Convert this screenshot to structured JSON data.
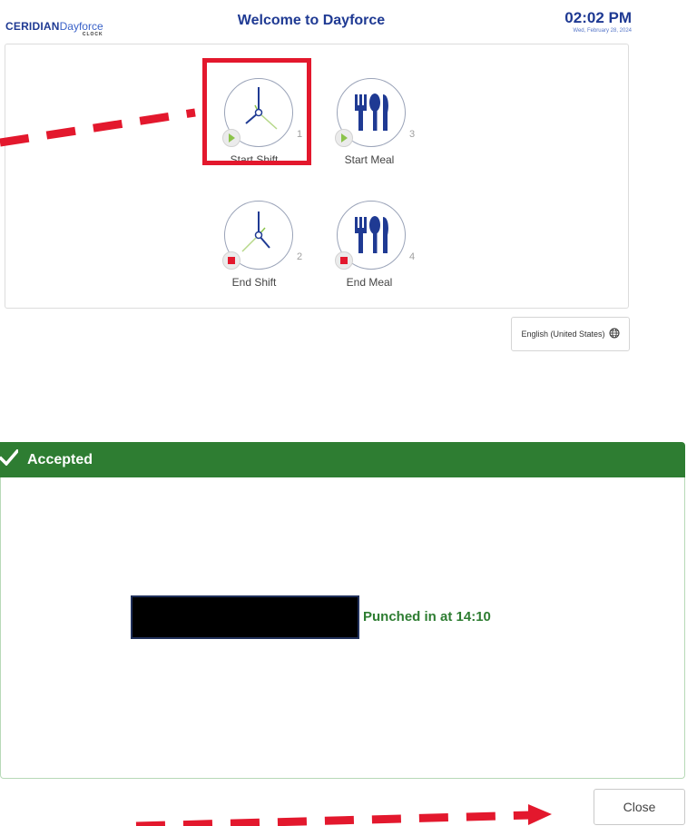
{
  "header": {
    "brand_primary": "CERIDIAN",
    "brand_secondary": "Dayforce",
    "brand_sub": "CLOCK",
    "title": "Welcome to Dayforce",
    "time": "02:02 PM",
    "date": "Wed, February 28, 2024"
  },
  "tiles": [
    {
      "label": "Start Shift",
      "number": "1",
      "icon": "clock-icon",
      "badge": "play-icon"
    },
    {
      "label": "Start Meal",
      "number": "3",
      "icon": "fork-knife-icon",
      "badge": "play-icon"
    },
    {
      "label": "End Shift",
      "number": "2",
      "icon": "clock-icon",
      "badge": "stop-icon"
    },
    {
      "label": "End Meal",
      "number": "4",
      "icon": "fork-knife-icon",
      "badge": "stop-icon"
    }
  ],
  "language": {
    "label": "English (United States)",
    "icon": "globe-icon"
  },
  "dialog": {
    "status": "Accepted",
    "message": "Punched in at 14:10",
    "close_label": "Close"
  },
  "colors": {
    "brand_blue": "#1f3a93",
    "accepted_green": "#2e7d32",
    "highlight_red": "#e3182d",
    "play_green": "#8bc34a",
    "stop_red": "#e3182d"
  }
}
